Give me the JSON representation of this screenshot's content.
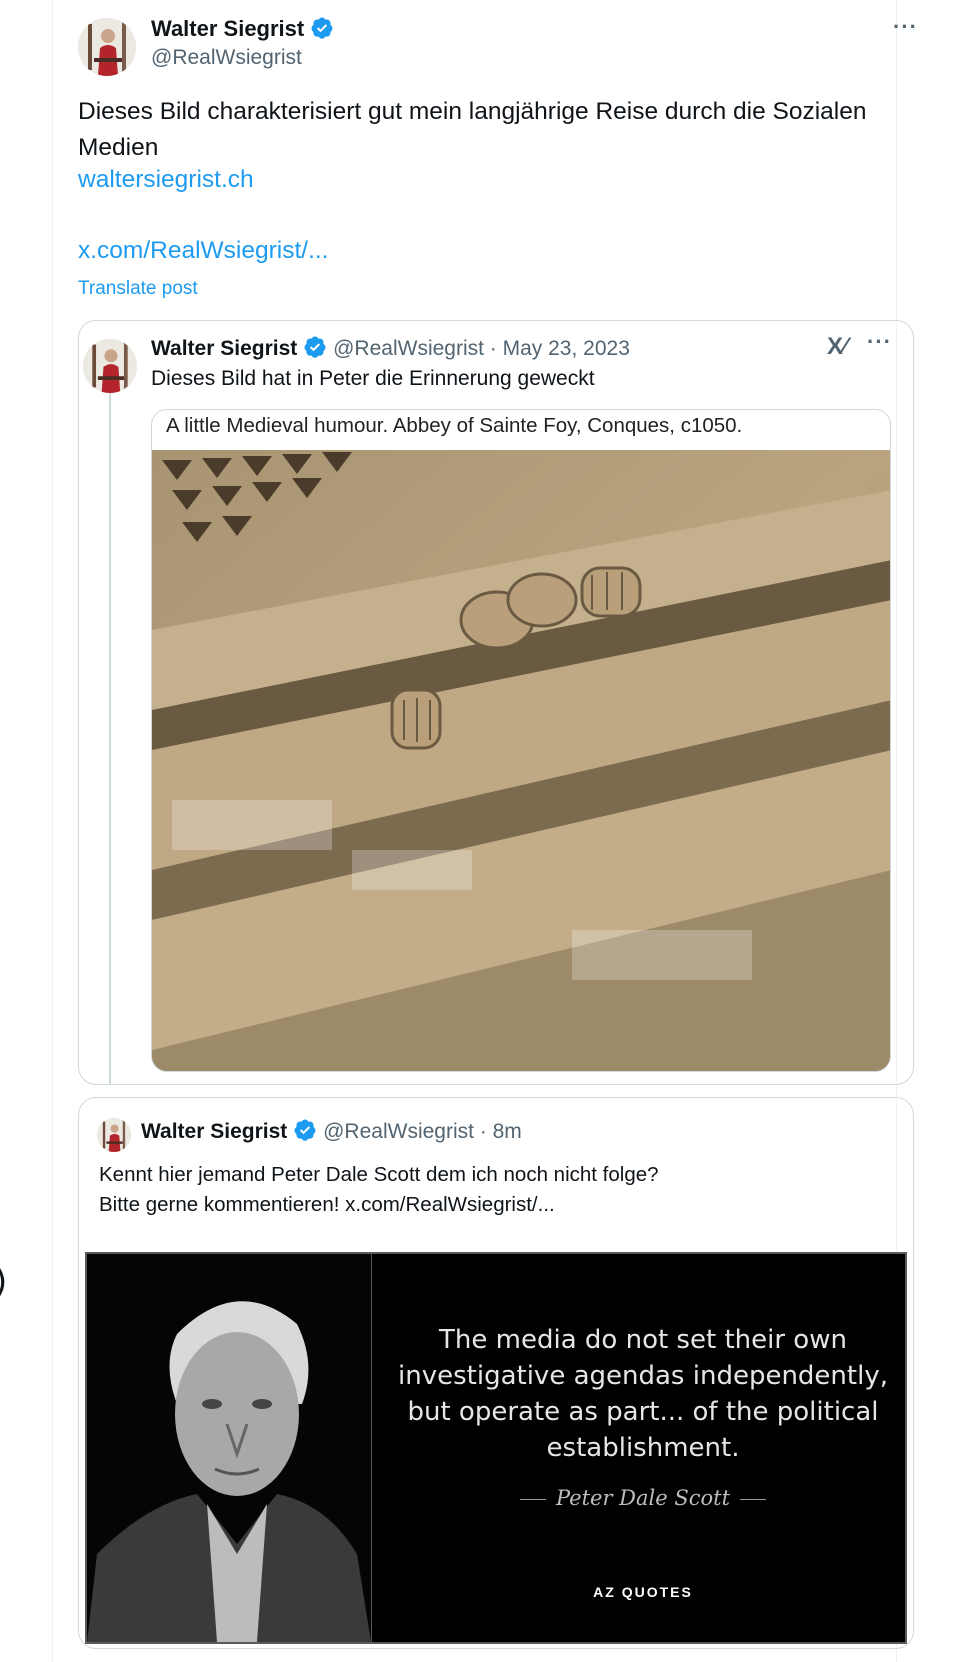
{
  "post": {
    "author_name": "Walter Siegrist",
    "author_handle": "@RealWsiegrist",
    "more_label": "···",
    "text": "Dieses Bild charakterisiert gut mein langjährige Reise durch die Sozialen Medien",
    "link1": "waltersiegrist.ch",
    "link2": "x.com/RealWsiegrist/...",
    "translate_label": "Translate post"
  },
  "quote1": {
    "author_name": "Walter Siegrist",
    "meta": "@RealWsiegrist · May 23, 2023",
    "grok_label": "X⁄",
    "more_label": "···",
    "text": "Dieses Bild hat in Peter die Erinnerung geweckt",
    "image_caption": "A little Medieval humour.  Abbey of Sainte Foy, Conques, c1050."
  },
  "quote2": {
    "author_name": "Walter Siegrist",
    "meta": "@RealWsiegrist · 8m",
    "text_line1": "Kennt hier jemand Peter Dale Scott dem ich noch nicht folge?",
    "text_line2": "Bitte gerne kommentieren!  x.com/RealWsiegrist/...",
    "image_quote": "The media do not set their own investigative agendas independently, but operate as part... of the political establishment.",
    "image_author": "Peter Dale Scott",
    "image_logo": "AZ QUOTES"
  },
  "colors": {
    "link": "#1d9bf0",
    "verified": "#1d9bf0",
    "secondary_text": "#536471",
    "border": "#cfd9de"
  },
  "icons": [
    "verified-badge-icon",
    "more-icon",
    "grok-icon"
  ]
}
